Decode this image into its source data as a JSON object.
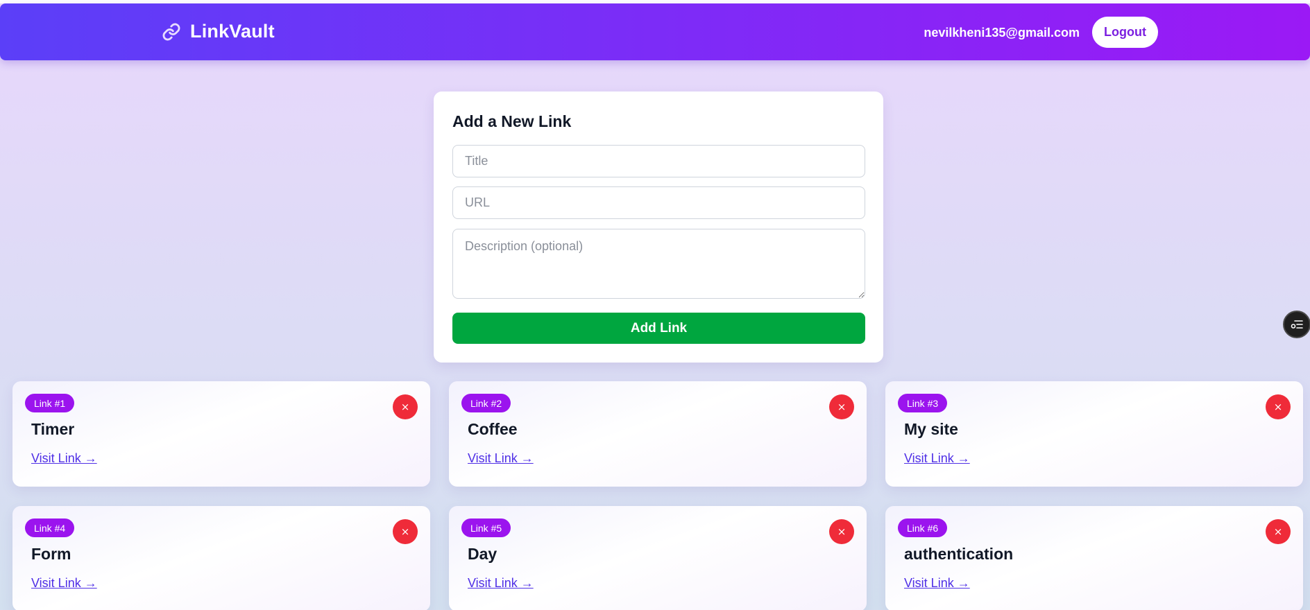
{
  "header": {
    "brand": "LinkVault",
    "user_email": "nevilkheni135@gmail.com",
    "logout_label": "Logout"
  },
  "form": {
    "title": "Add a New Link",
    "title_placeholder": "Title",
    "url_placeholder": "URL",
    "description_placeholder": "Description (optional)",
    "submit_label": "Add Link"
  },
  "links": [
    {
      "badge": "Link #1",
      "title": "Timer",
      "visit_label": "Visit Link →",
      "delete_symbol": "×"
    },
    {
      "badge": "Link #2",
      "title": "Coffee",
      "visit_label": "Visit Link →",
      "delete_symbol": "×"
    },
    {
      "badge": "Link #3",
      "title": "My site",
      "visit_label": "Visit Link →",
      "delete_symbol": "×"
    },
    {
      "badge": "Link #4",
      "title": "Form",
      "visit_label": "Visit Link →",
      "delete_symbol": "×"
    },
    {
      "badge": "Link #5",
      "title": "Day",
      "visit_label": "Visit Link →",
      "delete_symbol": "×"
    },
    {
      "badge": "Link #6",
      "title": "authentication",
      "visit_label": "Visit Link →",
      "delete_symbol": "×"
    }
  ],
  "icons": {
    "brand": "link-chain-icon",
    "floating": "extension-toggle-icon",
    "delete": "close-icon"
  },
  "colors": {
    "header_gradient_start": "#5b3ff8",
    "header_gradient_end": "#9b19f5",
    "accent_purple": "#9b14ee",
    "add_button_green": "#00a63f",
    "delete_red": "#ef2b39",
    "link_blue": "#4f2fe6"
  }
}
